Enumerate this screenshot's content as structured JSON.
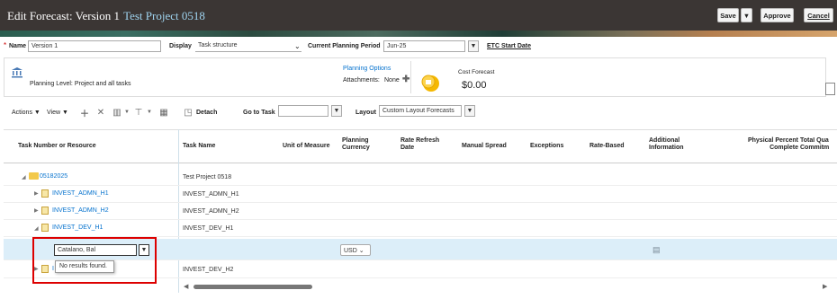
{
  "header": {
    "title": "Edit Forecast: Version 1",
    "project": "Test Project 0518",
    "save_label": "Save",
    "approve_label": "Approve",
    "cancel_label": "Cancel"
  },
  "form": {
    "name_label": "Name",
    "name_value": "Version 1",
    "display_label": "Display",
    "display_value": "Task structure",
    "period_label": "Current Planning Period",
    "period_value": "Jun-25",
    "etc_label": "ETC Start Date"
  },
  "panel": {
    "planning_level": "Planning Level: Project and all tasks",
    "planning_options": "Planning Options",
    "attachments_label": "Attachments:",
    "attachments_value": "None",
    "cost_forecast_label": "Cost Forecast",
    "cost_forecast_value": "$0.00"
  },
  "toolbar": {
    "actions": "Actions ▼",
    "view": "View ▼",
    "detach": "Detach",
    "go_to_task": "Go to Task",
    "layout_label": "Layout",
    "layout_value": "Custom Layout Forecasts"
  },
  "columns": [
    "Task Number or Resource",
    "Task Name",
    "Unit of Measure",
    "Planning Currency",
    "Rate Refresh Date",
    "Manual Spread",
    "Exceptions",
    "Rate-Based",
    "Additional Information",
    "Physical Percent Complete",
    "Total Qua Commitm"
  ],
  "rows": [
    {
      "number": "05182025",
      "name": "Test Project 0518"
    },
    {
      "number": "INVEST_ADMN_H1",
      "name": "INVEST_ADMN_H1"
    },
    {
      "number": "INVEST_ADMN_H2",
      "name": "INVEST_ADMN_H2"
    },
    {
      "number": "INVEST_DEV_H1",
      "name": "INVEST_DEV_H1"
    },
    {
      "number": "",
      "name": ""
    },
    {
      "number": "I",
      "name": "INVEST_DEV_H2"
    }
  ],
  "edit_row": {
    "resource_value": "Catalano, Bal",
    "currency_value": "USD"
  },
  "popup": {
    "message": "No results found."
  },
  "colors": {
    "header_bg": "#3b3634",
    "project_link": "#9fd4f0",
    "link": "#0572ce",
    "selected_row": "#dceef9",
    "highlight_box": "#dd0000"
  }
}
